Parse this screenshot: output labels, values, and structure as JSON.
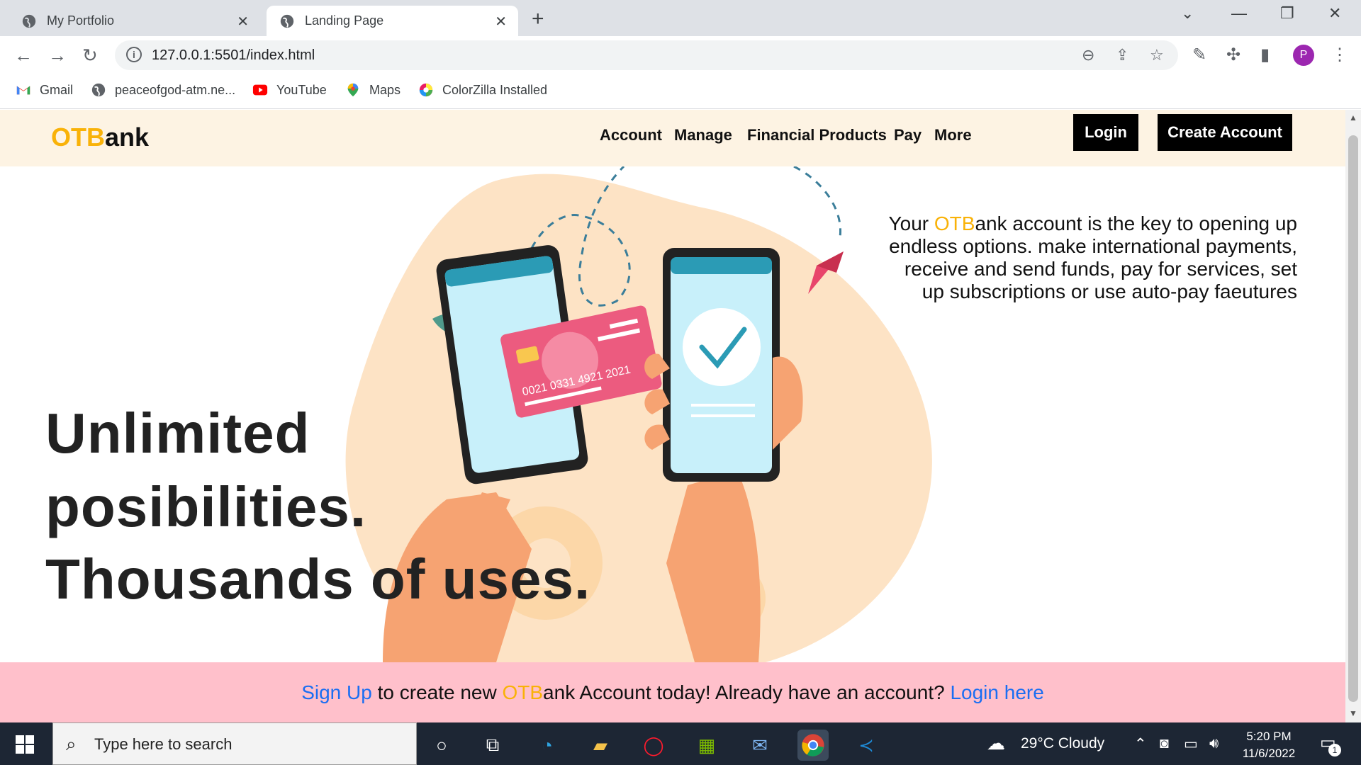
{
  "browser": {
    "tabs": [
      {
        "title": "My Portfolio",
        "active": false
      },
      {
        "title": "Landing Page",
        "active": true
      }
    ],
    "new_tab_icon": "plus-icon",
    "url": "127.0.0.1:5501/index.html",
    "profile_initial": "P",
    "bookmarks": [
      {
        "label": "Gmail",
        "icon": "gmail-icon"
      },
      {
        "label": "peaceofgod-atm.ne...",
        "icon": "globe-icon"
      },
      {
        "label": "YouTube",
        "icon": "youtube-icon"
      },
      {
        "label": "Maps",
        "icon": "maps-icon"
      },
      {
        "label": "ColorZilla Installed",
        "icon": "colorzilla-icon"
      }
    ]
  },
  "site": {
    "logo": {
      "accent": "OTB",
      "rest": "ank"
    },
    "nav": [
      "Account",
      "Manage",
      "Financial Products",
      "Pay",
      "More"
    ],
    "login_label": "Login",
    "create_account_label": "Create Account",
    "hero": {
      "line1": "Unlimited",
      "line2": "posibilities.",
      "line3": "Thousands of uses.",
      "copy_prefix": "Your ",
      "copy_accent": "OTB",
      "copy_rest": "ank account is the key to opening up endless options. make international payments, receive and send funds, pay for services, set up subscriptions or use auto-pay faeutures"
    },
    "card_number": "0021 0331 4921 2021",
    "cta": {
      "signup": "Sign Up",
      "middle1": " to create new ",
      "accent": "OTB",
      "middle2": "ank Account today! Already have an account? ",
      "login": "Login here"
    }
  },
  "taskbar": {
    "search_placeholder": "Type here to search",
    "weather": "29°C  Cloudy",
    "time": "5:20 PM",
    "date": "11/6/2022",
    "notifications": "1"
  },
  "colors": {
    "accent": "#f9b208",
    "header_bg": "#fdf3e3",
    "cta_bg": "#ffc0cb",
    "link": "#1a6ef2"
  }
}
